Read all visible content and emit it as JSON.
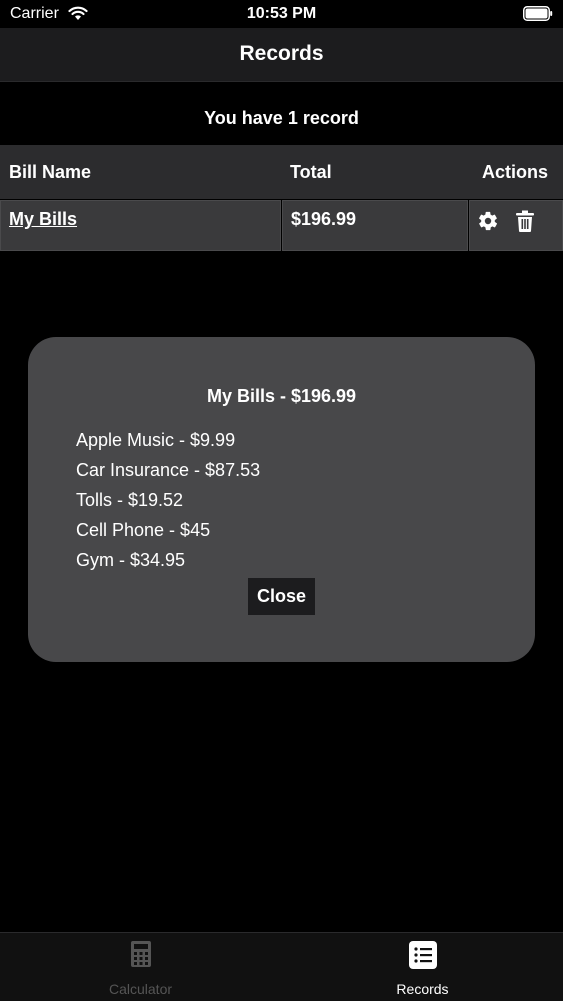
{
  "status_bar": {
    "carrier": "Carrier",
    "time": "10:53 PM"
  },
  "nav": {
    "title": "Records"
  },
  "records": {
    "count_text": "You have 1 record",
    "columns": [
      "Bill Name",
      "Total",
      "Actions"
    ],
    "rows": [
      {
        "name": "My Bills",
        "total": "$196.99"
      }
    ]
  },
  "modal": {
    "title": "My Bills - $196.99",
    "items": [
      "Apple Music - $9.99",
      "Car Insurance - $87.53",
      "Tolls - $19.52",
      "Cell Phone - $45",
      "Gym - $34.95"
    ],
    "close_label": "Close"
  },
  "tabs": [
    {
      "label": "Calculator",
      "icon": "calculator-icon",
      "active": false
    },
    {
      "label": "Records",
      "icon": "list-icon",
      "active": true
    }
  ],
  "colors": {
    "background": "#000000",
    "nav_bar": "#1c1c1e",
    "table_header": "#2c2c2e",
    "table_cell": "#3a3a3c",
    "modal": "#48484a",
    "inactive_tab": "#555555"
  }
}
